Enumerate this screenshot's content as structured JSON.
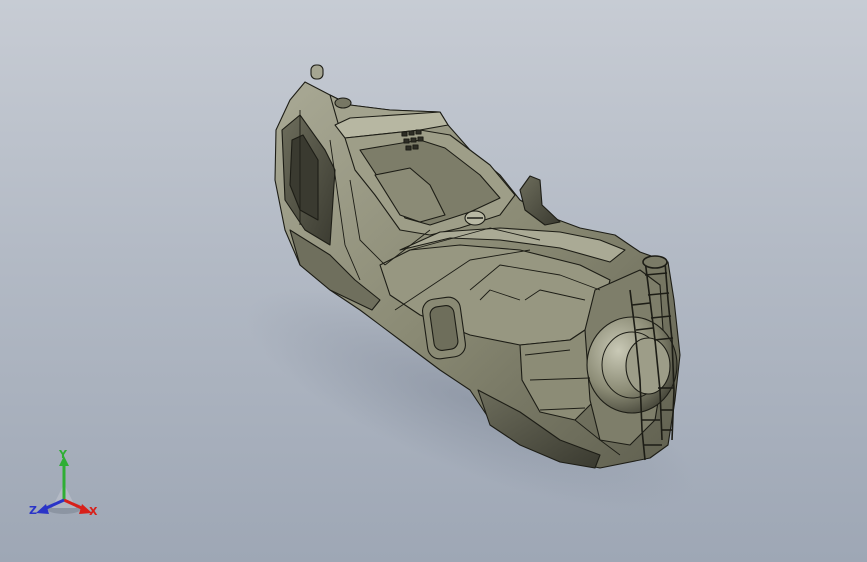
{
  "triad": {
    "x_label": "X",
    "y_label": "Y",
    "z_label": "Z",
    "colors": {
      "x": "#d8201a",
      "y": "#2fae34",
      "z": "#2a34c8"
    }
  },
  "model": {
    "icon": "vehicle-3d-model",
    "body_color": "#8f8f7a",
    "edge_color": "#1d1d16"
  },
  "viewport": {
    "background_top": "#c7ccd4",
    "background_bottom": "#9ea7b5"
  }
}
